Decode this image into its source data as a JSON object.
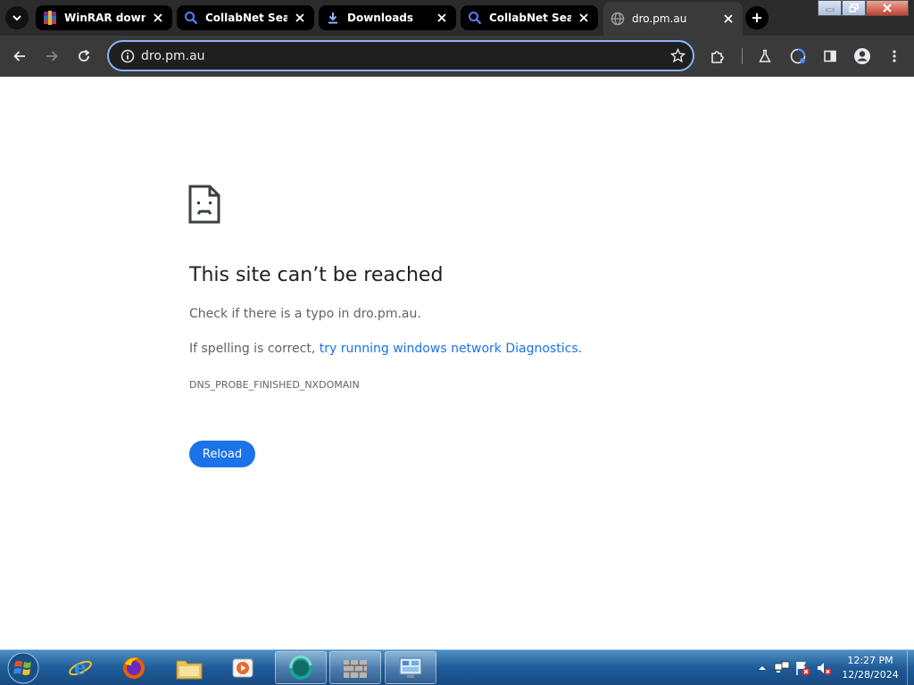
{
  "browser": {
    "tabs": [
      {
        "title": "WinRAR downlo",
        "icon": "winrar-icon",
        "active": false
      },
      {
        "title": "CollabNet SearX",
        "icon": "search-icon",
        "active": false
      },
      {
        "title": "Downloads",
        "icon": "download-icon",
        "active": false
      },
      {
        "title": "CollabNet SearX",
        "icon": "search-icon",
        "active": false
      },
      {
        "title": "dro.pm.au",
        "icon": "globe-icon",
        "active": true
      }
    ],
    "address": {
      "url": "dro.pm.au"
    },
    "colors": {
      "accent": "#8ab4f8",
      "tab_bg": "#000000",
      "toolbar_bg": "#3a3a3a"
    }
  },
  "error_page": {
    "title": "This site can’t be reached",
    "check_line": "Check if there is a typo in dro.pm.au.",
    "spelling_prefix": "If spelling is correct, ",
    "spelling_link": "try running windows network Diagnostics",
    "spelling_suffix": ".",
    "code": "DNS_PROBE_FINISHED_NXDOMAIN",
    "reload_label": "Reload",
    "colors": {
      "title": "#202124",
      "body": "#5f6368",
      "link": "#1a73e8",
      "button": "#1a73e8"
    }
  },
  "taskbar": {
    "pinned": [
      "internet-explorer-icon",
      "firefox-icon",
      "file-explorer-icon",
      "media-player-icon",
      "chrome-icon",
      "firewall-icon",
      "control-panel-icon"
    ],
    "clock": {
      "time": "12:27 PM",
      "date": "12/28/2024"
    }
  }
}
